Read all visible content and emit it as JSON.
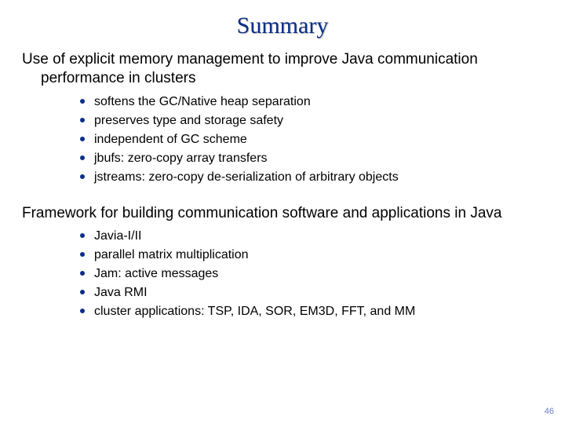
{
  "title": "Summary",
  "sections": [
    {
      "text": "Use of explicit memory management to improve Java communication performance in clusters",
      "bullets": [
        "softens the GC/Native heap separation",
        "preserves type and storage safety",
        "independent of GC scheme",
        "jbufs: zero-copy array transfers",
        "jstreams: zero-copy de-serialization of arbitrary objects"
      ]
    },
    {
      "text": "Framework for building communication software and applications in Java",
      "bullets": [
        "Javia-I/II",
        "parallel matrix multiplication",
        "Jam: active messages",
        "Java RMI",
        "cluster applications: TSP, IDA, SOR, EM3D, FFT, and MM"
      ]
    }
  ],
  "page_number": "46"
}
